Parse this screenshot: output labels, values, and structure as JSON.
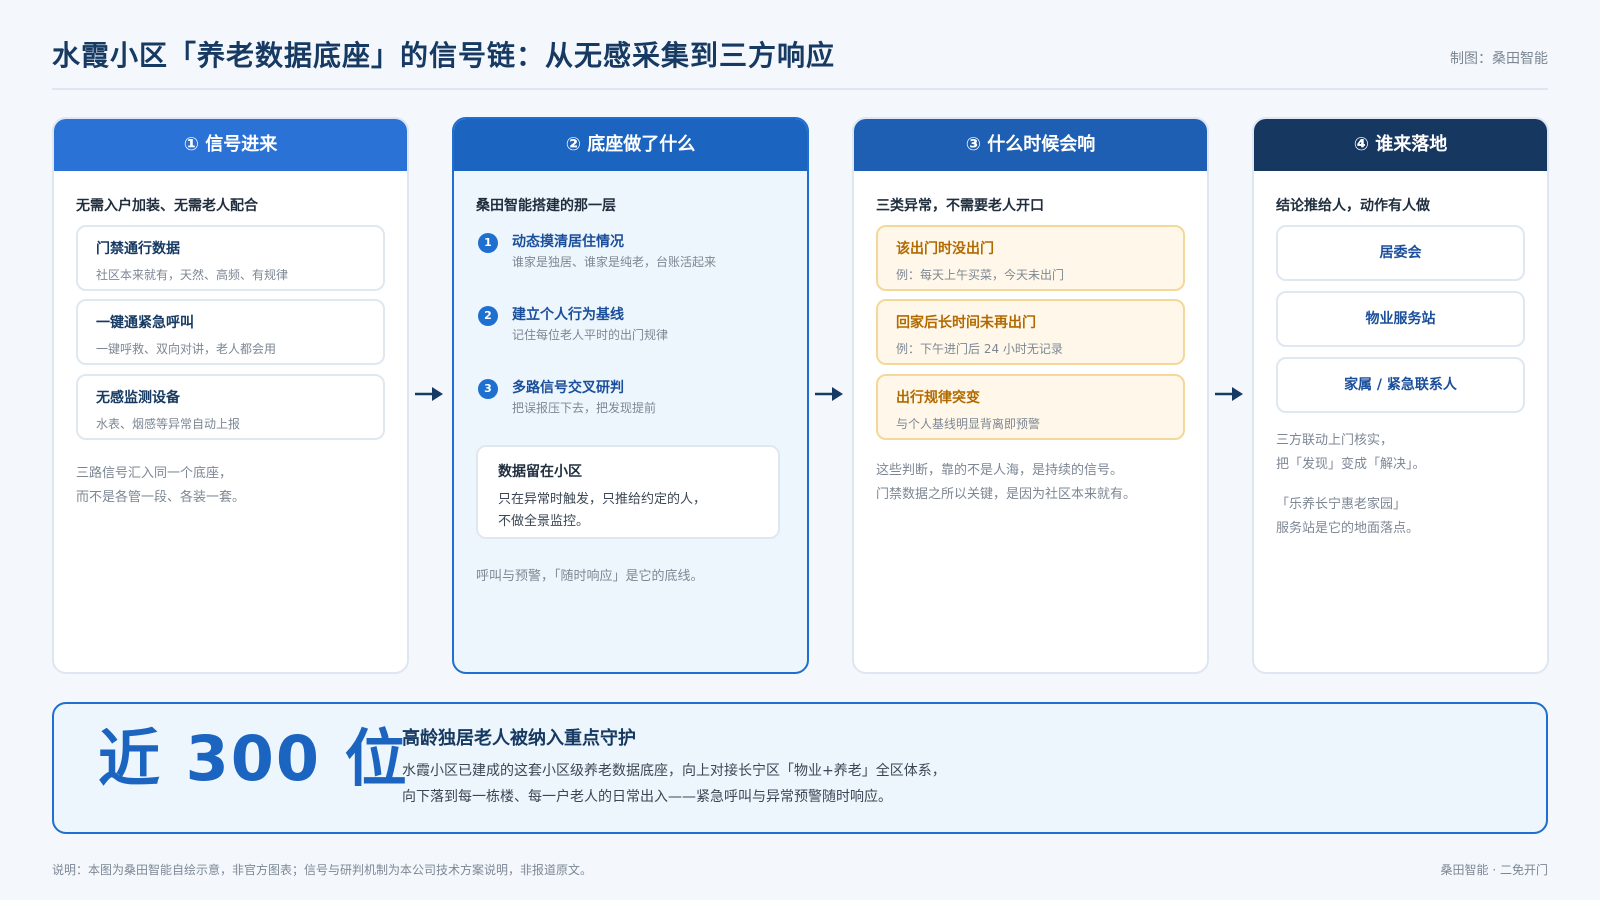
{
  "header": {
    "title": "水霞小区「养老数据底座」的信号链：从无感采集到三方响应",
    "credit": "制图：桑田智能"
  },
  "columns": [
    {
      "head": "① 信号进来",
      "sub": "无需入户加装、无需老人配合",
      "cards": [
        {
          "title": "门禁通行数据",
          "desc": "社区本来就有，天然、高频、有规律"
        },
        {
          "title": "一键通紧急呼叫",
          "desc": "一键呼救、双向对讲，老人都会用"
        },
        {
          "title": "无感监测设备",
          "desc": "水表、烟感等异常自动上报"
        }
      ],
      "note": [
        "三路信号汇入同一个底座，",
        "而不是各管一段、各装一套。"
      ]
    },
    {
      "head": "② 底座做了什么",
      "sub": "桑田智能搭建的那一层",
      "steps": [
        {
          "num": "1",
          "title": "动态摸清居住情况",
          "desc": "谁家是独居、谁家是纯老，台账活起来"
        },
        {
          "num": "2",
          "title": "建立个人行为基线",
          "desc": "记住每位老人平时的出门规律"
        },
        {
          "num": "3",
          "title": "多路信号交叉研判",
          "desc": "把误报压下去，把发现提前"
        }
      ],
      "keep": {
        "title": "数据留在小区",
        "lines": [
          "只在异常时触发，只推给约定的人，",
          "不做全景监控。"
        ]
      },
      "note": [
        "呼叫与预警，「随时响应」是它的底线。"
      ]
    },
    {
      "head": "③ 什么时候会响",
      "sub": "三类异常，不需要老人开口",
      "cards": [
        {
          "title": "该出门时没出门",
          "desc": "例：每天上午买菜，今天未出门"
        },
        {
          "title": "回家后长时间未再出门",
          "desc": "例：下午进门后 24 小时无记录"
        },
        {
          "title": "出行规律突变",
          "desc": "与个人基线明显背离即预警"
        }
      ],
      "note": [
        "这些判断，靠的不是人海，是持续的信号。",
        "门禁数据之所以关键，是因为社区本来就有。"
      ]
    },
    {
      "head": "④ 谁来落地",
      "sub": "结论推给人，动作有人做",
      "who": [
        "居委会",
        "物业服务站",
        "家属 / 紧急联系人"
      ],
      "note": [
        "三方联动上门核实，",
        "把「发现」变成「解决」。",
        "",
        "「乐养长宁惠老家园」",
        "服务站是它的地面落点。"
      ]
    }
  ],
  "banner": {
    "big": "近 300 位",
    "title": "高龄独居老人被纳入重点守护",
    "lines": [
      "水霞小区已建成的这套小区级养老数据底座，向上对接长宁区「物业+养老」全区体系，",
      "向下落到每一栋楼、每一户老人的日常出入——紧急呼叫与异常预警随时响应。"
    ]
  },
  "footer": {
    "left": "说明：本图为桑田智能自绘示意，非官方图表；信号与研判机制为本公司技术方案说明，非报道原文。",
    "right": "桑田智能 · 二免开门"
  },
  "colors": {
    "primary": "#1e6fcf",
    "navy": "#163760",
    "warn_bg": "#fff8ea",
    "warn_text": "#b26a00"
  },
  "icons": [
    "arrow-right-icon"
  ]
}
